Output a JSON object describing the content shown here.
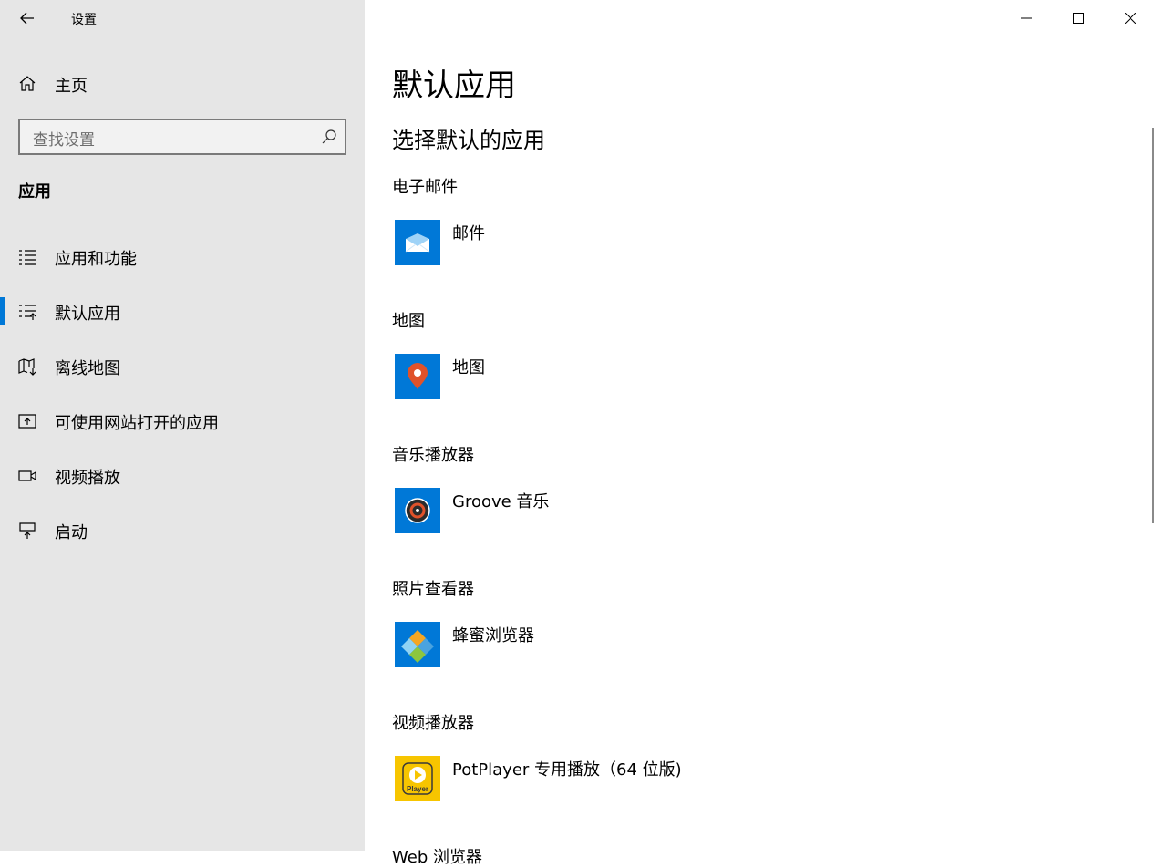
{
  "window": {
    "title": "设置"
  },
  "sidebar": {
    "home_label": "主页",
    "search_placeholder": "查找设置",
    "section_title": "应用",
    "items": [
      {
        "label": "应用和功能",
        "icon": "apps-features-icon",
        "selected": false
      },
      {
        "label": "默认应用",
        "icon": "default-apps-icon",
        "selected": true
      },
      {
        "label": "离线地图",
        "icon": "offline-maps-icon",
        "selected": false
      },
      {
        "label": "可使用网站打开的应用",
        "icon": "apps-for-websites-icon",
        "selected": false
      },
      {
        "label": "视频播放",
        "icon": "video-playback-icon",
        "selected": false
      },
      {
        "label": "启动",
        "icon": "startup-icon",
        "selected": false
      }
    ]
  },
  "main": {
    "title": "默认应用",
    "subtitle": "选择默认的应用",
    "groups": [
      {
        "category": "电子邮件",
        "app": "邮件",
        "icon": "mail-app-icon"
      },
      {
        "category": "地图",
        "app": "地图",
        "icon": "maps-app-icon"
      },
      {
        "category": "音乐播放器",
        "app": "Groove 音乐",
        "icon": "groove-music-icon"
      },
      {
        "category": "照片查看器",
        "app": "蜂蜜浏览器",
        "icon": "honeyview-icon"
      },
      {
        "category": "视频播放器",
        "app": "PotPlayer 专用播放（64 位版)",
        "icon": "potplayer-icon"
      },
      {
        "category": "Web 浏览器",
        "app": "",
        "icon": ""
      }
    ]
  },
  "colors": {
    "accent": "#0078d7",
    "sidebar_bg": "#e6e6e6",
    "main_bg": "#ffffff"
  }
}
